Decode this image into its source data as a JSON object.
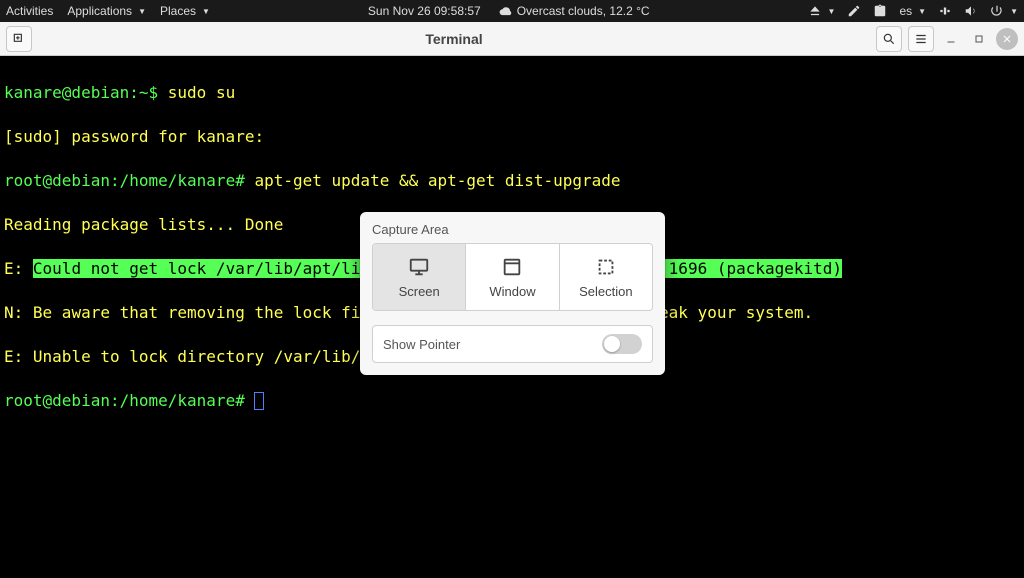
{
  "panel": {
    "activities": "Activities",
    "applications": "Applications",
    "places": "Places",
    "datetime": "Sun Nov 26  09:58:57",
    "weather": "Overcast clouds, 12.2 °C",
    "keyboard_layout": "es"
  },
  "titlebar": {
    "title": "Terminal"
  },
  "terminal": {
    "prompt1_user": "kanare@debian",
    "prompt1_sep": ":",
    "prompt1_path": "~",
    "prompt1_dollar": "$ ",
    "cmd1": "sudo su",
    "sudo_line": "[sudo] password for kanare:",
    "root_prompt_user": "root@debian",
    "root_prompt_path": ":/home/kanare",
    "root_prompt_hash": "# ",
    "cmd2": "apt-get update && apt-get dist-upgrade",
    "reading": "Reading package lists... Done",
    "err_e1_prefix": "E: ",
    "err_e1_msg": "Could not get lock /var/lib/apt/lists/lock. It is held by process 1696 (packagekitd)",
    "err_n_prefix": "N: ",
    "err_n_msg": "Be aware that removing the lock file is not a solution and may break your system.",
    "err_e2_prefix": "E: ",
    "err_e2_msg": "Unable to lock directory /var/lib/apt/lists/"
  },
  "popup": {
    "title": "Capture Area",
    "options": [
      {
        "label": "Screen",
        "icon": "monitor-icon",
        "active": true
      },
      {
        "label": "Window",
        "icon": "window-icon",
        "active": false
      },
      {
        "label": "Selection",
        "icon": "selection-icon",
        "active": false
      }
    ],
    "show_pointer_label": "Show Pointer",
    "show_pointer_on": false
  }
}
